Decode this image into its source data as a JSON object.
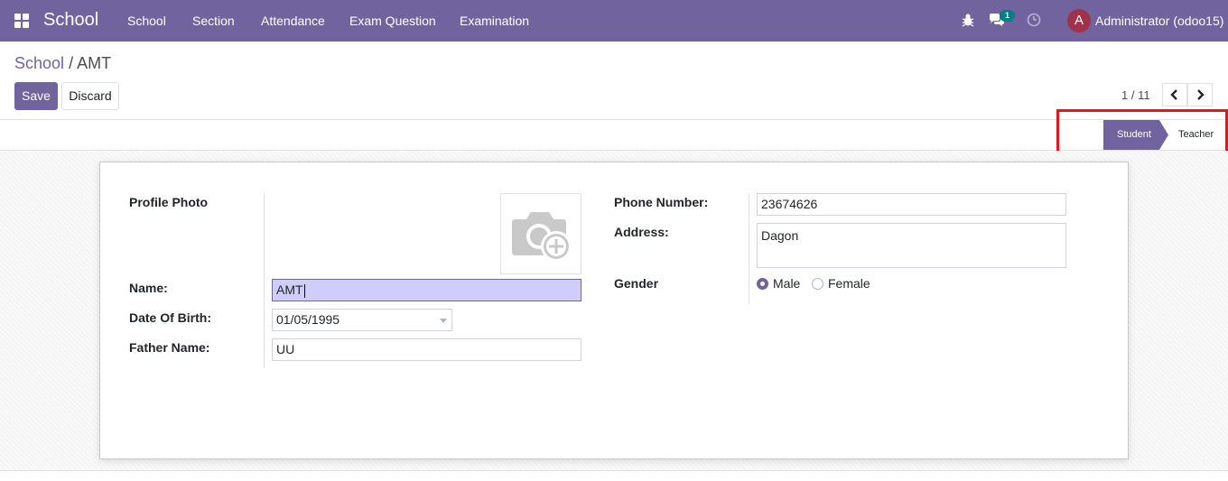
{
  "navbar": {
    "app_name": "School",
    "menu": [
      "School",
      "Section",
      "Attendance",
      "Exam Question",
      "Examination"
    ],
    "notification_count": "1",
    "user_initial": "A",
    "user_name": "Administrator (odoo15)"
  },
  "breadcrumb": {
    "parent": "School",
    "separator": "/",
    "current": "AMT"
  },
  "buttons": {
    "save": "Save",
    "discard": "Discard"
  },
  "pager": {
    "value": "1 / 11"
  },
  "statusbar": {
    "stages": [
      "Student",
      "Teacher"
    ],
    "active": "Student"
  },
  "form": {
    "profile_photo_label": "Profile Photo",
    "name_label": "Name:",
    "name_value": "AMT",
    "dob_label": "Date Of Birth:",
    "dob_value": "01/05/1995",
    "father_label": "Father Name:",
    "father_value": "UU",
    "phone_label": "Phone Number:",
    "phone_value": "23674626",
    "address_label": "Address:",
    "address_value": "Dagon",
    "gender_label": "Gender",
    "gender_options": [
      "Male",
      "Female"
    ],
    "gender_selected": "Male"
  },
  "colors": {
    "brand": "#71639e",
    "highlight": "#e3151f",
    "badge": "#017e84",
    "avatar": "#a1324b"
  }
}
